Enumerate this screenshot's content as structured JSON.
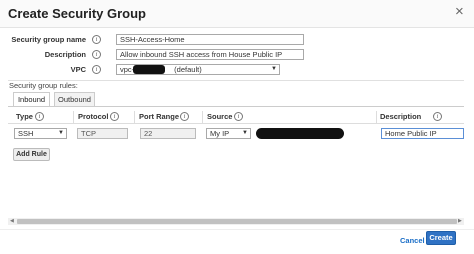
{
  "dialog": {
    "title": "Create Security Group",
    "close_label": "×"
  },
  "form": {
    "group_name": {
      "label": "Security group name",
      "value": "SSH-Access-Home"
    },
    "description": {
      "label": "Description",
      "value": "Allow inbound SSH access from House Public IP"
    },
    "vpc": {
      "label": "VPC",
      "value_prefix": "vpc-",
      "value_suffix": "(default)"
    }
  },
  "rules": {
    "section_label": "Security group rules:",
    "tabs": [
      {
        "label": "Inbound",
        "active": true
      },
      {
        "label": "Outbound",
        "active": false
      }
    ],
    "columns": [
      "Type",
      "Protocol",
      "Port Range",
      "Source",
      "Description"
    ],
    "rows": [
      {
        "type": "SSH",
        "protocol": "TCP",
        "port_range": "22",
        "source": "My IP",
        "description": "Home Public IP"
      }
    ],
    "add_rule_label": "Add Rule"
  },
  "footer": {
    "cancel_label": "Cancel",
    "create_label": "Create"
  },
  "icons": {
    "info": "info-icon",
    "close": "close-icon",
    "dropdown": "chevron-down-icon"
  },
  "colors": {
    "primary": "#2f72c4",
    "link": "#1a6ec7"
  }
}
